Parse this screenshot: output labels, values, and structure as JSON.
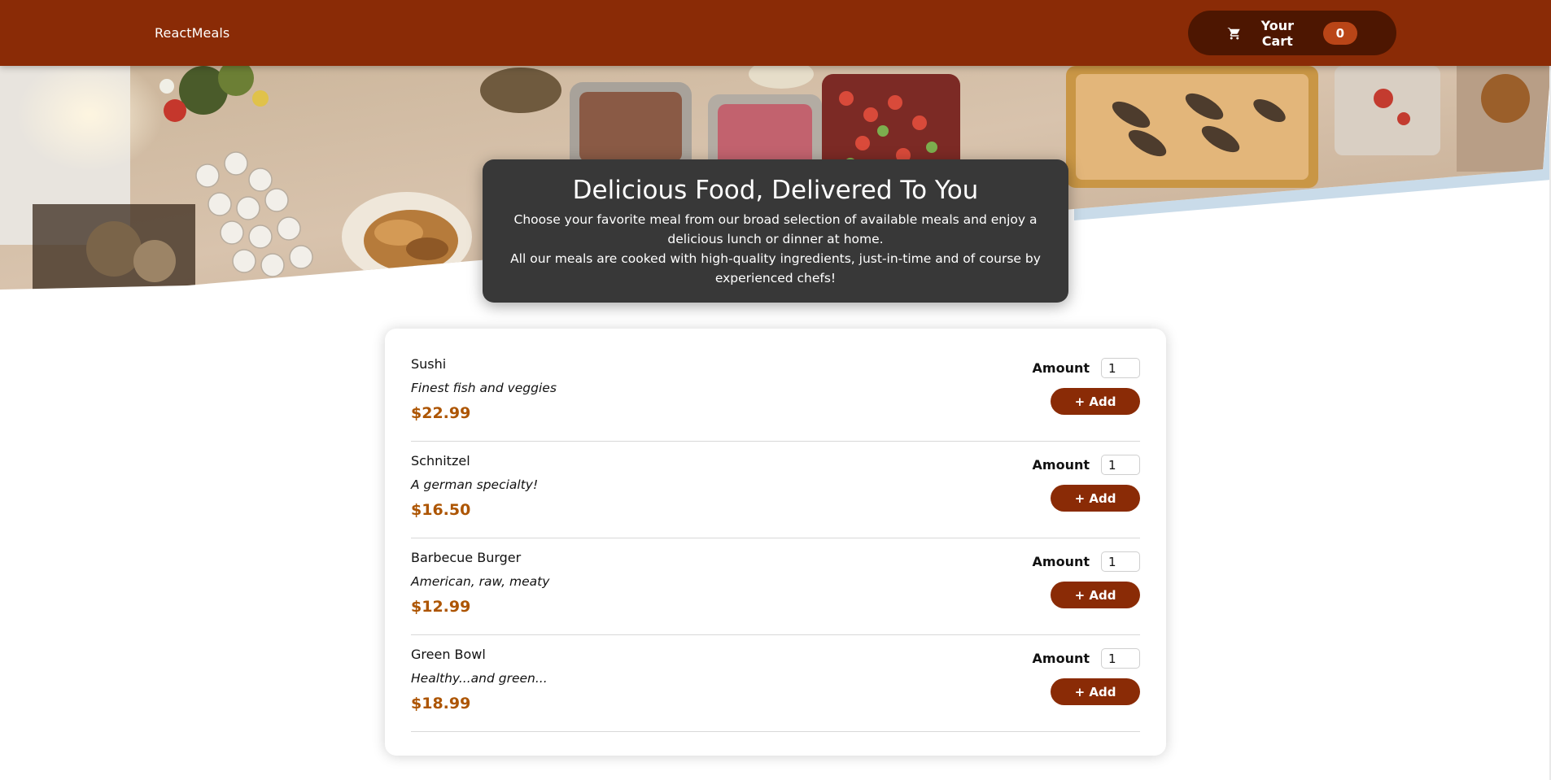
{
  "header": {
    "brand": "ReactMeals",
    "cart": {
      "label": "Your Cart",
      "count": "0"
    }
  },
  "summary": {
    "title": "Delicious Food, Delivered To You",
    "paragraph_1": "Choose your favorite meal from our broad selection of available meals and enjoy a delicious lunch or dinner at home.",
    "paragraph_2": "All our meals are cooked with high-quality ingredients, just-in-time and of course by experienced chefs!"
  },
  "meals": {
    "amount_label": "Amount",
    "add_label": "+ Add",
    "items": [
      {
        "name": "Sushi",
        "description": "Finest fish and veggies",
        "price": "$22.99",
        "amount": "1"
      },
      {
        "name": "Schnitzel",
        "description": "A german specialty!",
        "price": "$16.50",
        "amount": "1"
      },
      {
        "name": "Barbecue Burger",
        "description": "American, raw, meaty",
        "price": "$12.99",
        "amount": "1"
      },
      {
        "name": "Green Bowl",
        "description": "Healthy...and green...",
        "price": "$18.99",
        "amount": "1"
      }
    ]
  },
  "colors": {
    "header": "#8a2b06",
    "cart_button": "#4d1601",
    "cart_badge": "#b94517",
    "summary_bg": "#383838",
    "price": "#ad5502",
    "add_button": "#8a2b06"
  },
  "icons": {
    "cart": "shopping-cart-icon"
  }
}
